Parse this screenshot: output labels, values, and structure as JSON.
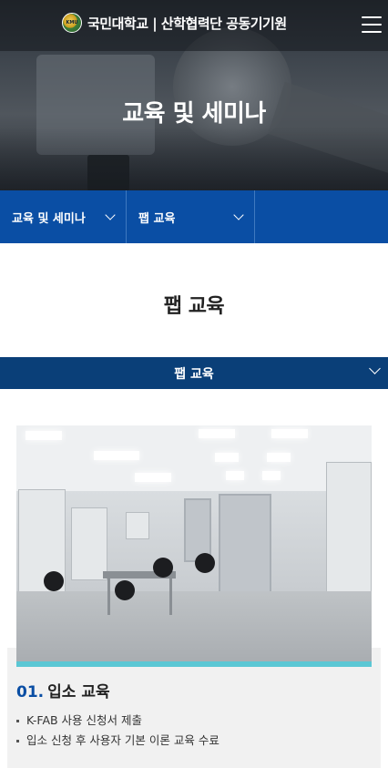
{
  "header": {
    "logo_text": "국민대학교 | 산학협력단 공동기기원",
    "logo_mark_text": "KMU",
    "menu_icon": "hamburger-menu-icon"
  },
  "hero": {
    "title": "교육 및 세미나"
  },
  "nav": {
    "items": [
      {
        "label": "교육 및 세미나",
        "icon": "chevron-down-icon"
      },
      {
        "label": "팹 교육",
        "icon": "chevron-down-icon"
      },
      {
        "label": ""
      }
    ]
  },
  "page": {
    "title": "팹 교육"
  },
  "submenu": {
    "selected": "팹 교육",
    "icon": "chevron-down-icon"
  },
  "card": {
    "number": "01.",
    "title": "입소 교육",
    "bullets": [
      "K-FAB 사용 신청서 제출",
      "입소 신청 후 사용자 기본 이론 교육 수료"
    ]
  },
  "colors": {
    "nav_blue": "#0a4ea4",
    "dropdown_navy": "#0a3f78",
    "accent_number": "#0a4ea4",
    "photo_strip": "#5bc7d4"
  }
}
